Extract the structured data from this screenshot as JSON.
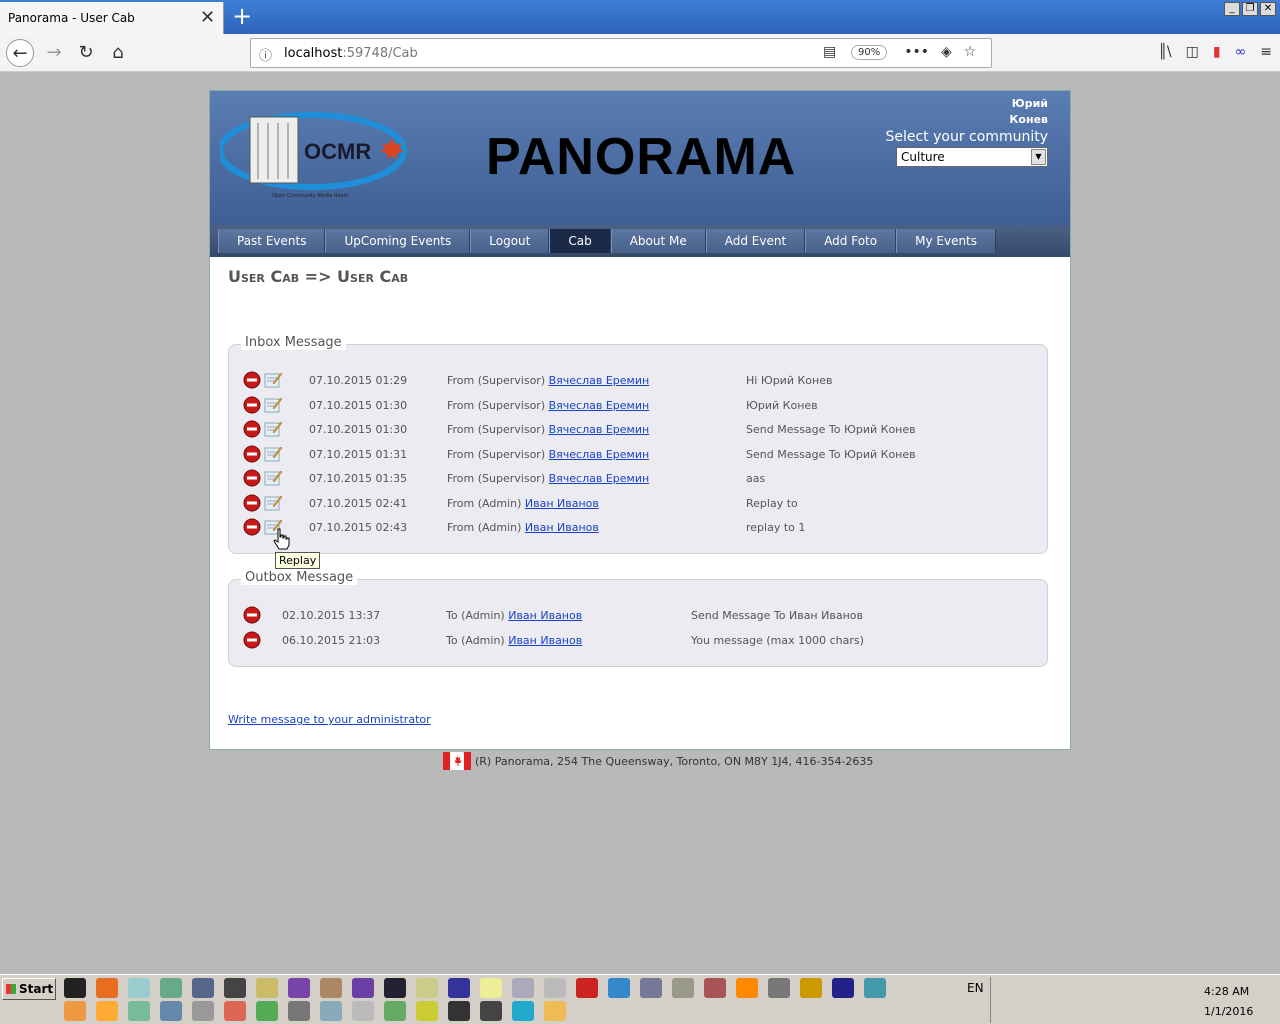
{
  "browser": {
    "tab_title": "Panorama - User Cab",
    "url_host": "localhost",
    "url_rest": ":59748/Cab",
    "zoom": "90%"
  },
  "header": {
    "site_title": "PANORAMA",
    "logo_text": "OCMR",
    "logo_subtext": "Open Community Media Room",
    "user_name": "Юрий Конев",
    "community_label": "Select your community",
    "community_selected": "Culture"
  },
  "menu": {
    "items": [
      {
        "label": "Past Events"
      },
      {
        "label": "UpComing Events"
      },
      {
        "label": "Logout"
      },
      {
        "label": "Cab"
      },
      {
        "label": "About Me"
      },
      {
        "label": "Add Event"
      },
      {
        "label": "Add Foto"
      },
      {
        "label": "My Events"
      }
    ],
    "active_index": 3
  },
  "page_heading": "User Cab => User Cab",
  "inbox": {
    "legend": "Inbox Message",
    "rows": [
      {
        "date": "07.10.2015 01:29",
        "from_prefix": "From (Supervisor)",
        "from_name": "Вячеслав Еремин",
        "subject": "Hi Юрий Конев"
      },
      {
        "date": "07.10.2015 01:30",
        "from_prefix": "From (Supervisor)",
        "from_name": "Вячеслав Еремин",
        "subject": "Юрий Конев"
      },
      {
        "date": "07.10.2015 01:30",
        "from_prefix": "From (Supervisor)",
        "from_name": "Вячеслав Еремин",
        "subject": "Send Message To Юрий Конев"
      },
      {
        "date": "07.10.2015 01:31",
        "from_prefix": "From (Supervisor)",
        "from_name": "Вячеслав Еремин",
        "subject": "Send Message To Юрий Конев"
      },
      {
        "date": "07.10.2015 01:35",
        "from_prefix": "From (Supervisor)",
        "from_name": "Вячеслав Еремин",
        "subject": "aas"
      },
      {
        "date": "07.10.2015 02:41",
        "from_prefix": "From (Admin)",
        "from_name": "Иван Иванов",
        "subject": "Replay to"
      },
      {
        "date": "07.10.2015 02:43",
        "from_prefix": "From (Admin)",
        "from_name": "Иван Иванов",
        "subject": "replay to 1"
      }
    ]
  },
  "tooltip": "Replay",
  "outbox": {
    "legend": "Outbox Message",
    "rows": [
      {
        "date": "02.10.2015 13:37",
        "to_prefix": "To (Admin)",
        "to_name": "Иван Иванов",
        "subject": "Send Message To Иван Иванов"
      },
      {
        "date": "06.10.2015 21:03",
        "to_prefix": "To (Admin)",
        "to_name": "Иван Иванов",
        "subject": "You message (max 1000 chars)"
      }
    ]
  },
  "write_link": "Write message to your administrator",
  "footer": "(R) Panorama, 254 The Queensway, Toronto, ON M8Y 1J4, 416-354-2635",
  "taskbar": {
    "start_label": "Start",
    "lang": "EN",
    "time": "4:28 AM",
    "date": "1/1/2016"
  },
  "colors": {
    "header_bg": "#4a6ca4",
    "menu_active": "#1c2a4a",
    "link": "#1a44c8",
    "box_bg": "#ebebf1"
  }
}
